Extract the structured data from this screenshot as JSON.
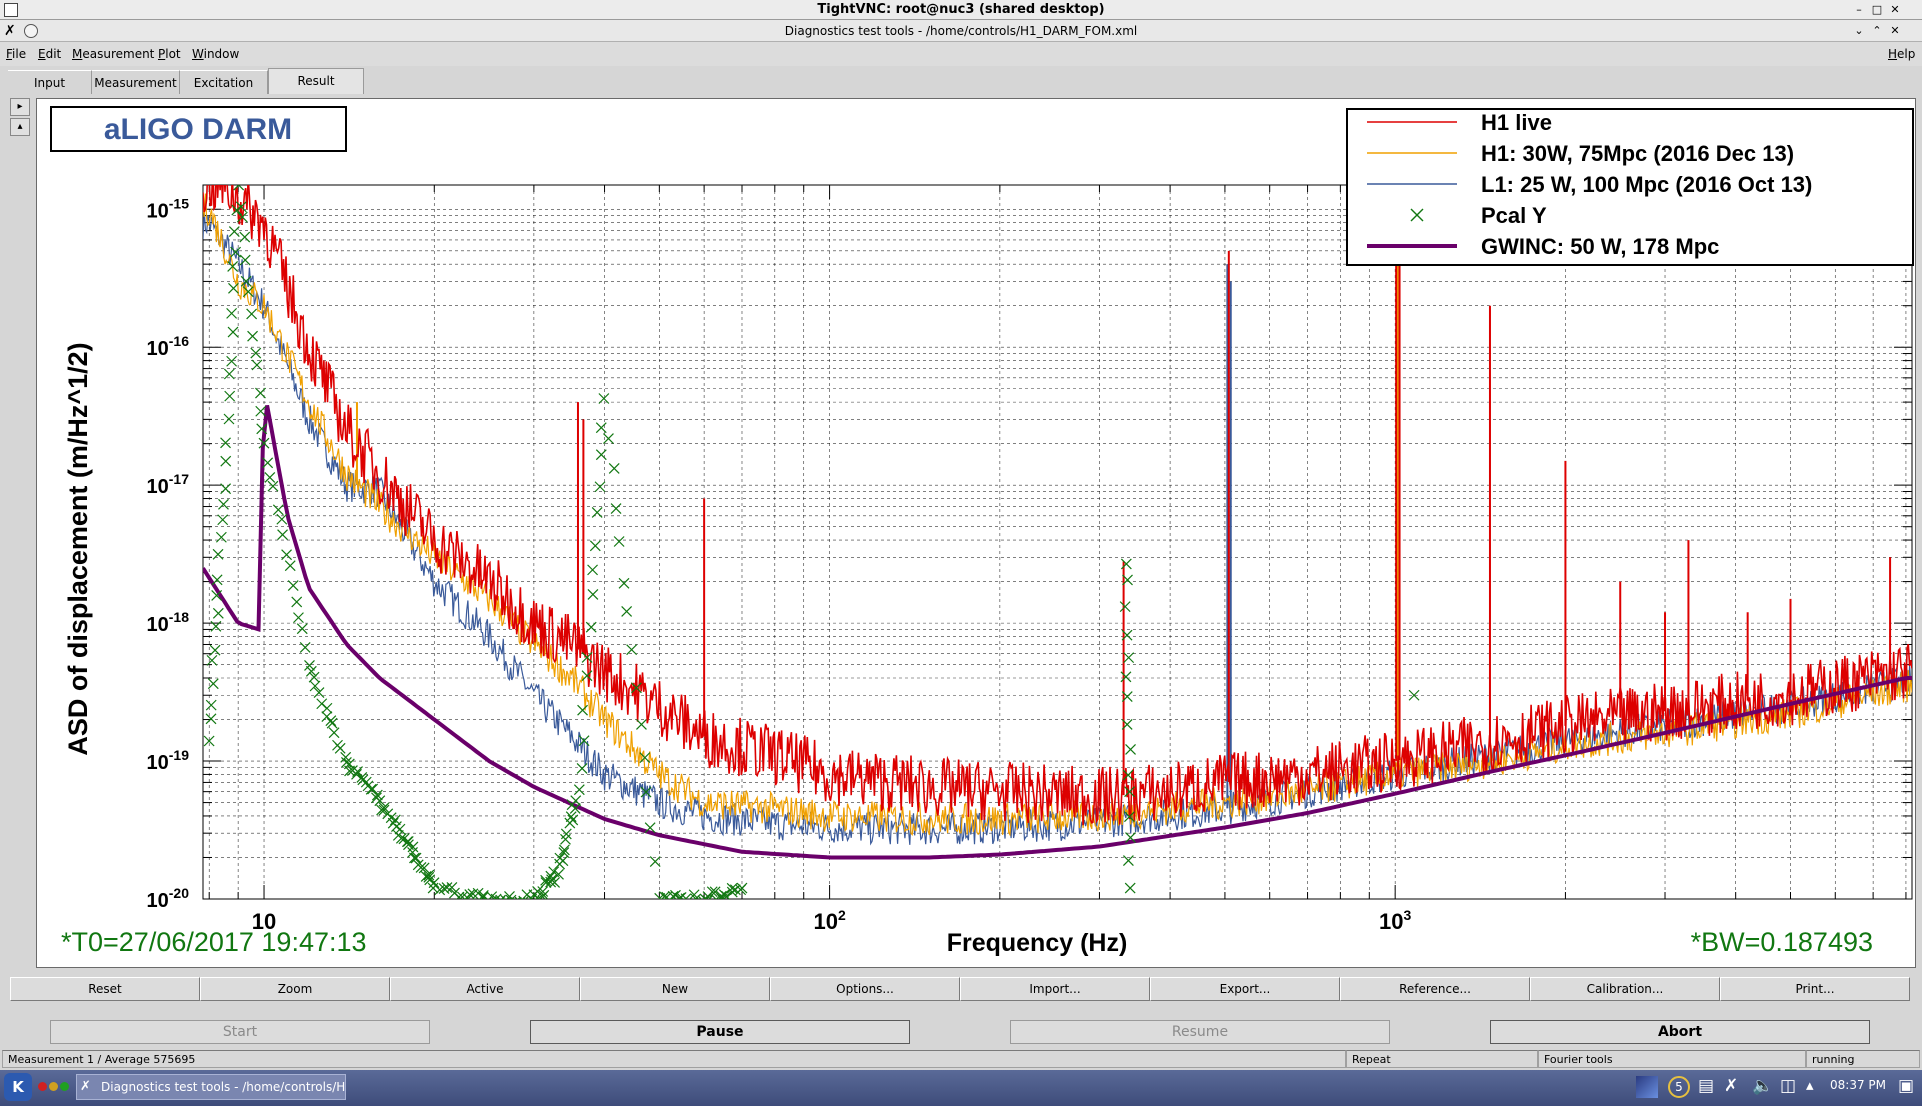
{
  "vnc": {
    "title": "TightVNC: root@nuc3 (shared desktop)"
  },
  "app": {
    "title": "Diagnostics test tools - /home/controls/H1_DARM_FOM.xml"
  },
  "menu": {
    "items": [
      {
        "label": "File"
      },
      {
        "label": "Edit"
      },
      {
        "label": "Measurement"
      },
      {
        "label": "Plot"
      },
      {
        "label": "Window"
      }
    ],
    "help": "Help"
  },
  "tabs": [
    {
      "label": "Input"
    },
    {
      "label": "Measurement"
    },
    {
      "label": "Excitation"
    },
    {
      "label": "Result",
      "active": true
    }
  ],
  "plot": {
    "title_box": "aLIGO DARM",
    "t0": "*T0=27/06/2017 19:47:13",
    "bw": "*BW=0.187493"
  },
  "toolbar": {
    "buttons": [
      "Reset",
      "Zoom",
      "Active",
      "New",
      "Options...",
      "Import...",
      "Export...",
      "Reference...",
      "Calibration...",
      "Print..."
    ]
  },
  "controls": {
    "start": "Start",
    "pause": "Pause",
    "resume": "Resume",
    "abort": "Abort"
  },
  "status": {
    "measurement": "Measurement 1 / Average 575695",
    "repeat": "Repeat",
    "tool": "Fourier tools",
    "state": "running"
  },
  "taskbar": {
    "item": "Diagnostics test tools - /home/controls/H1",
    "clock": "08:37 PM"
  },
  "colors": {
    "h1_live": "#dd0000",
    "h1_30w": "#f0a000",
    "l1_25w": "#3a5a9a",
    "pcal": "#117711",
    "gwinc": "#6a006a",
    "title_box": "#3a5a9a"
  },
  "chart_data": {
    "type": "line",
    "title": "",
    "xlabel": "Frequency (Hz)",
    "ylabel": "ASD of displacement (m/Hz^1/2)",
    "xscale": "log",
    "yscale": "log",
    "xlim": [
      7.8,
      8200
    ],
    "ylim": [
      1e-20,
      1.5e-15
    ],
    "x_ticks": [
      "10",
      "10^2",
      "10^3"
    ],
    "y_ticks": [
      "10^-15",
      "10^-16",
      "10^-17",
      "10^-18",
      "10^-19",
      "10^-20"
    ],
    "grid": true,
    "legend_position": "top-right",
    "legend": [
      {
        "name": "H1 live",
        "style": "line",
        "color": "#dd0000"
      },
      {
        "name": "H1: 30W, 75Mpc (2016 Dec 13)",
        "style": "line",
        "color": "#f0a000"
      },
      {
        "name": "L1: 25 W, 100 Mpc (2016 Oct 13)",
        "style": "line",
        "color": "#3a5a9a"
      },
      {
        "name": "Pcal Y",
        "style": "marker-x",
        "color": "#117711"
      },
      {
        "name": "GWINC: 50 W, 178 Mpc",
        "style": "line-thick",
        "color": "#6a006a"
      }
    ],
    "series": [
      {
        "name": "H1 live",
        "x": [
          8.5,
          10,
          12,
          14,
          16,
          20,
          25,
          30,
          35,
          40,
          50,
          60,
          80,
          100,
          150,
          200,
          300,
          400,
          500,
          700,
          1000,
          1500,
          2000,
          3000,
          5000,
          8000
        ],
        "y": [
          1.5e-15,
          8e-16,
          1e-16,
          2.5e-17,
          1.2e-17,
          4e-18,
          2e-18,
          1e-18,
          7e-19,
          4.5e-19,
          2.5e-19,
          1.5e-19,
          1.1e-19,
          8e-20,
          6.5e-20,
          6e-20,
          5.5e-20,
          6e-20,
          7e-20,
          8e-20,
          1e-19,
          1.4e-19,
          1.8e-19,
          2.3e-19,
          3e-19,
          4.5e-19
        ]
      },
      {
        "name": "H1: 30W, 75Mpc (2016 Dec 13)",
        "x": [
          8,
          9,
          10,
          12,
          14,
          16,
          20,
          25,
          30,
          35,
          40,
          50,
          60,
          80,
          100,
          150,
          200,
          300,
          500,
          700,
          1000,
          1500,
          2000,
          3000,
          5000,
          8000
        ],
        "y": [
          1e-15,
          3e-16,
          2e-16,
          4e-17,
          1.2e-17,
          7e-18,
          3e-18,
          1.5e-18,
          7e-19,
          4e-19,
          2e-19,
          8e-20,
          5e-20,
          4.5e-20,
          4e-20,
          3.8e-20,
          3.8e-20,
          4e-20,
          5e-20,
          6e-20,
          8e-20,
          1e-19,
          1.3e-19,
          1.6e-19,
          2.2e-19,
          3.5e-19
        ]
      },
      {
        "name": "L1: 25 W, 100 Mpc (2016 Oct 13)",
        "x": [
          8,
          9,
          10,
          12,
          14,
          16,
          20,
          25,
          30,
          35,
          40,
          50,
          60,
          80,
          100,
          150,
          200,
          300,
          500,
          700,
          1000,
          1500,
          2000,
          3000,
          5000,
          8000
        ],
        "y": [
          8e-16,
          4e-16,
          2e-16,
          3e-17,
          1e-17,
          9e-18,
          2e-18,
          8e-19,
          3e-19,
          1.5e-19,
          8e-20,
          5e-20,
          4e-20,
          3.5e-20,
          3.3e-20,
          3.2e-20,
          3.3e-20,
          3.6e-20,
          4.5e-20,
          6e-20,
          8e-20,
          1.1e-19,
          1.4e-19,
          1.8e-19,
          2.5e-19,
          3.8e-19
        ]
      },
      {
        "name": "Pcal Y",
        "x": [
          8,
          8.5,
          9,
          10,
          12,
          14,
          16,
          18,
          20,
          25,
          30,
          33,
          36,
          40,
          50,
          60,
          70,
          335,
          340,
          1080
        ],
        "y": [
          1.5e-19,
          1e-17,
          1.5e-15,
          2e-17,
          5e-19,
          1e-19,
          5e-20,
          2.5e-20,
          1.2e-20,
          1e-20,
          1e-20,
          1.5e-20,
          6e-20,
          4e-17,
          1e-20,
          1e-20,
          1.2e-20,
          2.8e-18,
          1.2e-20,
          3e-19
        ]
      },
      {
        "name": "GWINC: 50 W, 178 Mpc",
        "x": [
          7.8,
          9,
          9.8,
          10,
          11,
          12,
          14,
          16,
          20,
          25,
          30,
          40,
          50,
          70,
          100,
          150,
          200,
          300,
          500,
          700,
          1000,
          1500,
          2000,
          3000,
          5000,
          8000
        ],
        "y": [
          2.5e-18,
          1e-18,
          9e-19,
          5e-17,
          6e-18,
          1.8e-18,
          7e-19,
          4e-19,
          2e-19,
          1e-19,
          6.5e-20,
          3.8e-20,
          2.9e-20,
          2.2e-20,
          2e-20,
          2e-20,
          2.1e-20,
          2.4e-20,
          3.3e-20,
          4.2e-20,
          5.8e-20,
          8.5e-20,
          1.1e-19,
          1.6e-19,
          2.6e-19,
          4e-19
        ]
      }
    ],
    "spikes": {
      "H1 live": [
        [
          35.9,
          4e-17
        ],
        [
          36.7,
          3e-17
        ],
        [
          60,
          8e-18
        ],
        [
          331,
          2.8e-18
        ],
        [
          508,
          5e-16
        ],
        [
          1004,
          1e-15
        ],
        [
          1018,
          5e-16
        ],
        [
          1471,
          2e-16
        ],
        [
          2000,
          1.5e-17
        ],
        [
          2500,
          2e-18
        ],
        [
          3000,
          1.2e-18
        ],
        [
          3300,
          4e-18
        ],
        [
          4200,
          1.2e-18
        ],
        [
          5000,
          1.5e-18
        ],
        [
          7500,
          3e-18
        ]
      ],
      "H1: 30W, 75Mpc (2016 Dec 13)": [
        [
          14.6,
          4e-17
        ],
        [
          1010,
          1.4e-15
        ]
      ],
      "L1: 25 W, 100 Mpc (2016 Oct 13)": [
        [
          505,
          4e-16
        ],
        [
          512,
          3e-16
        ],
        [
          1010,
          8e-16
        ]
      ]
    }
  }
}
